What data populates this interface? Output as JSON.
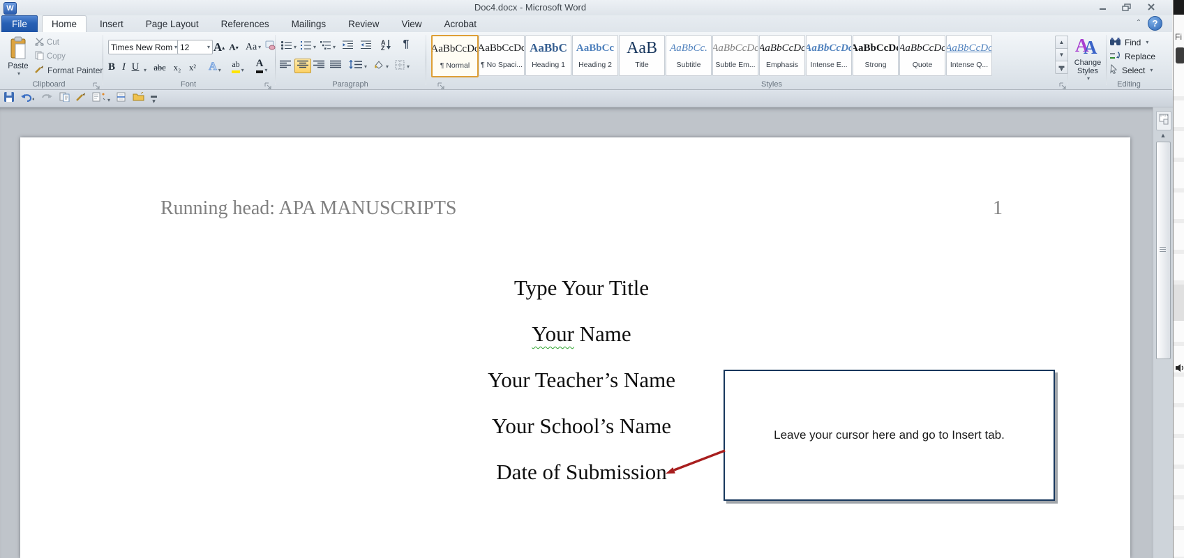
{
  "colors": {
    "file_tab_blue": "#2760B4",
    "selected_style_border": "#DE9F35",
    "active_align_orange": "#FCD165",
    "callout_border": "#17375D",
    "arrow_red": "#A81E1E",
    "header_gray": "#808080",
    "heading_blue": "#4F81BD",
    "title_navy": "#17365D"
  },
  "window": {
    "app_icon_letter": "W",
    "title": "Doc4.docx  -  Microsoft Word",
    "help": "?"
  },
  "tabs": {
    "file": "File",
    "items": [
      "Home",
      "Insert",
      "Page Layout",
      "References",
      "Mailings",
      "Review",
      "View",
      "Acrobat"
    ],
    "active": "Home"
  },
  "ribbon": {
    "clipboard": {
      "label": "Clipboard",
      "paste": "Paste",
      "cut": "Cut",
      "copy": "Copy",
      "format_painter": "Format Painter"
    },
    "font": {
      "label": "Font",
      "family": "Times New Rom",
      "size": "12",
      "bold": "B",
      "italic": "I",
      "underline": "U",
      "strikethrough": "abc",
      "subscript": "x₂",
      "superscript": "x²",
      "change_case": "Aa",
      "text_effects": "A",
      "highlight": "ab",
      "font_color": "A"
    },
    "paragraph": {
      "label": "Paragraph",
      "pilcrow": "¶",
      "sort_a": "A",
      "sort_z": "Z"
    },
    "styles": {
      "label": "Styles",
      "change_styles": "Change Styles",
      "change_styles_icon": "A",
      "items": [
        {
          "sample": "AaBbCcDc",
          "name": "¶ Normal"
        },
        {
          "sample": "AaBbCcDc",
          "name": "¶ No Spaci..."
        },
        {
          "sample": "AaBbC",
          "name": "Heading 1"
        },
        {
          "sample": "AaBbCc",
          "name": "Heading 2"
        },
        {
          "sample": "AaB",
          "name": "Title"
        },
        {
          "sample": "AaBbCc.",
          "name": "Subtitle"
        },
        {
          "sample": "AaBbCcDc",
          "name": "Subtle Em..."
        },
        {
          "sample": "AaBbCcDc",
          "name": "Emphasis"
        },
        {
          "sample": "AaBbCcDc",
          "name": "Intense E..."
        },
        {
          "sample": "AaBbCcDc",
          "name": "Strong"
        },
        {
          "sample": "AaBbCcDc",
          "name": "Quote"
        },
        {
          "sample": "AaBbCcDc",
          "name": "Intense Q..."
        }
      ]
    },
    "editing": {
      "label": "Editing",
      "find": "Find",
      "replace": "Replace",
      "select": "Select"
    }
  },
  "document": {
    "header": {
      "running_head": "Running head: APA MANUSCRIPTS",
      "page_number": "1"
    },
    "lines": [
      {
        "text": "Type Your Title"
      },
      {
        "parts": [
          "Your",
          " Name"
        ]
      },
      {
        "text": "Your Teacher’s Name"
      },
      {
        "text": "Your School’s Name"
      },
      {
        "text": "Date of Submission"
      }
    ],
    "callout": {
      "text": "Leave your cursor here and go to Insert tab."
    }
  },
  "side_window": {
    "menu": "Fi"
  }
}
